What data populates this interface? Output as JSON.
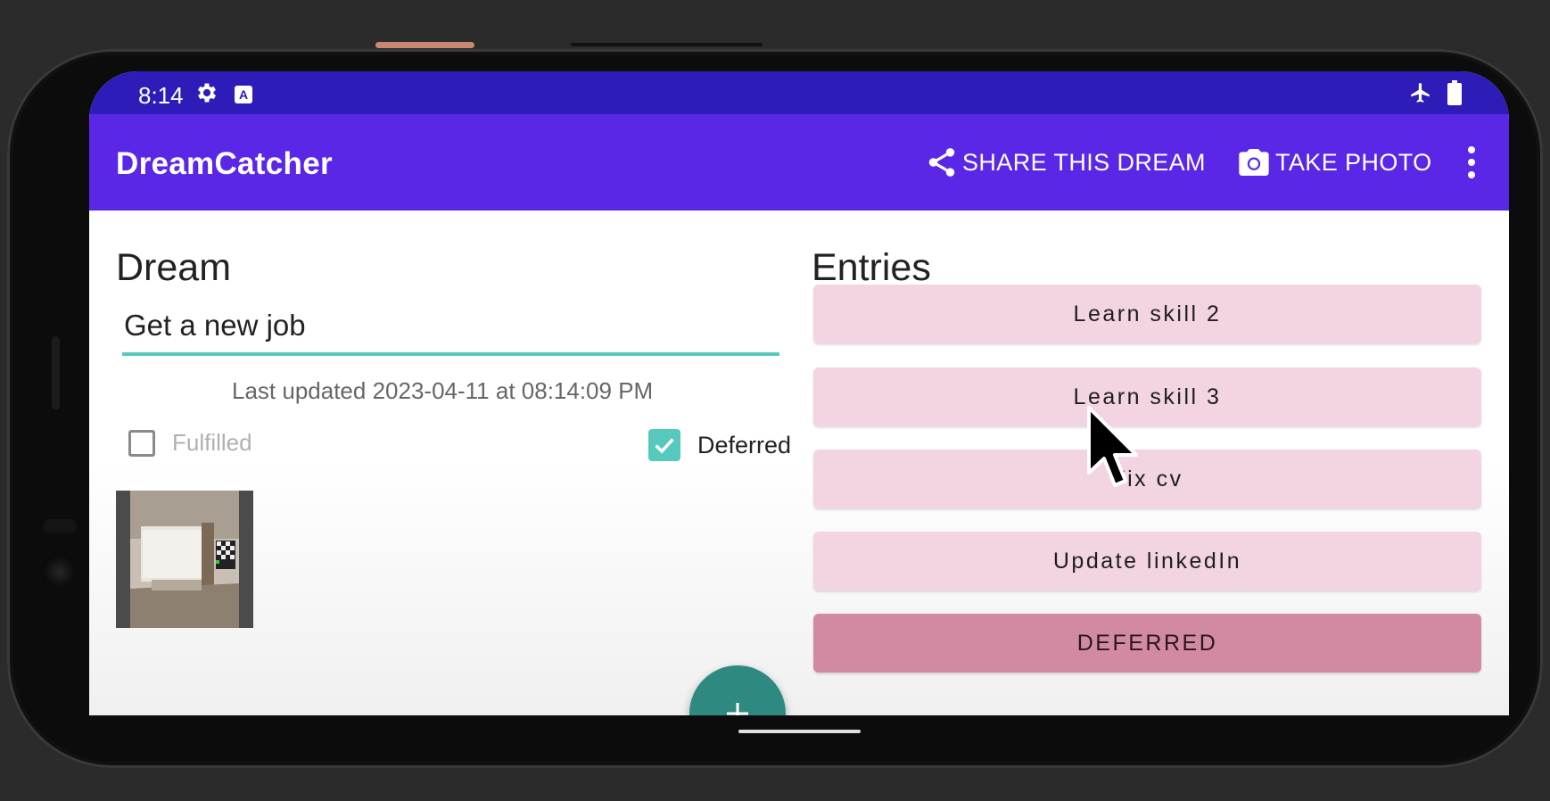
{
  "status_bar": {
    "time": "8:14",
    "icons": [
      "gear-icon",
      "a-keyboard-icon",
      "airplane-icon",
      "battery-icon"
    ]
  },
  "app_bar": {
    "title": "DreamCatcher",
    "share_label": "SHARE THIS DREAM",
    "photo_label": "TAKE PHOTO",
    "icons": [
      "share-icon",
      "camera-icon",
      "more-vert-icon"
    ]
  },
  "dream": {
    "heading": "Dream",
    "title_value": "Get a new job",
    "last_updated": "Last updated 2023-04-11 at 08:14:09 PM",
    "fulfilled_label": "Fulfilled",
    "fulfilled_checked": false,
    "deferred_label": "Deferred",
    "deferred_checked": true
  },
  "entries": {
    "heading": "Entries",
    "items": [
      {
        "label": "Learn skill 2"
      },
      {
        "label": "Learn skill 3"
      },
      {
        "label": "Fix cv"
      },
      {
        "label": "Update linkedIn"
      },
      {
        "label": "DEFERRED"
      }
    ]
  },
  "fab": {
    "icon": "plus-icon"
  },
  "colors": {
    "status_bar": "#2e1cb8",
    "app_bar": "#5a27e6",
    "accent": "#56c9bc",
    "fab": "#2e8a81",
    "entry_bg": "#f3d4e3",
    "deferred_bg": "#d18aa2"
  }
}
